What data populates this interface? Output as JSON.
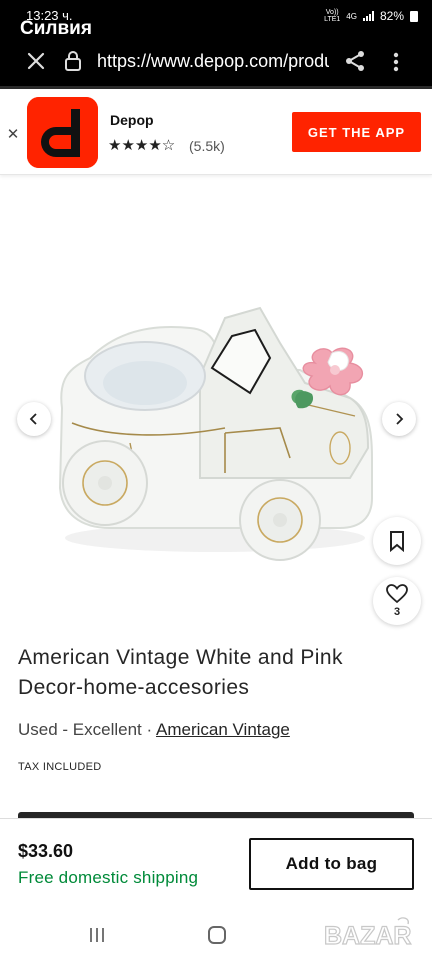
{
  "status_bar": {
    "time": "13:23 ч.",
    "contact_name": "Силвия",
    "network_top": "Vo))",
    "network_bottom": "LTE1",
    "network_type": "4G",
    "battery": "82%"
  },
  "browser": {
    "url": "https://www.depop.com/products",
    "icons": [
      "close-icon",
      "lock-icon",
      "share-icon",
      "more-vertical-icon"
    ]
  },
  "app_banner": {
    "app_name": "Depop",
    "stars": "★★★★☆",
    "rating_count": "(5.5k)",
    "cta_label": "GET THE APP",
    "logo_letter": "d",
    "brand_color": "#ff2300"
  },
  "product": {
    "title": "American Vintage White and Pink Decor-home-accesories",
    "condition": "Used - Excellent",
    "separator": "·",
    "brand": "American Vintage",
    "tax_note": "TAX INCLUDED",
    "like_count": "3",
    "image_icons": [
      "chevron-left-icon",
      "chevron-right-icon",
      "bookmark-icon",
      "heart-icon"
    ]
  },
  "purchase": {
    "price": "$33.60",
    "shipping": "Free domestic shipping",
    "add_to_bag_label": "Add to bag",
    "shipping_color": "#008a39"
  },
  "watermark": {
    "text": "BAZAR"
  }
}
